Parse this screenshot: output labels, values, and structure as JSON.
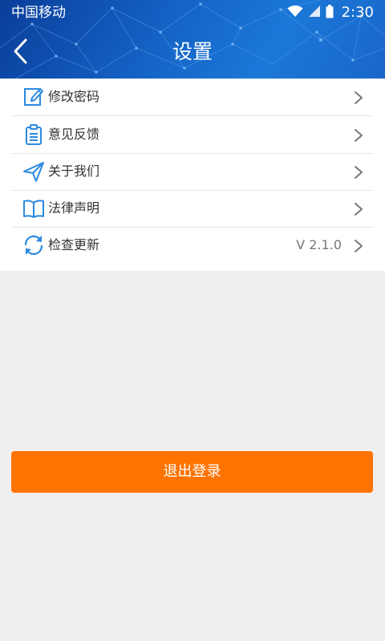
{
  "status_bar": {
    "carrier": "中国移动",
    "time": "2:30",
    "icons": [
      "wifi-icon",
      "signal-icon",
      "battery-icon"
    ]
  },
  "header": {
    "title": "设置",
    "back_icon": "chevron-left-icon"
  },
  "menu": {
    "items": [
      {
        "label": "修改密码",
        "icon": "edit-icon",
        "value": ""
      },
      {
        "label": "意见反馈",
        "icon": "clipboard-icon",
        "value": ""
      },
      {
        "label": "关于我们",
        "icon": "paper-plane-icon",
        "value": ""
      },
      {
        "label": "法律声明",
        "icon": "book-icon",
        "value": ""
      },
      {
        "label": "检查更新",
        "icon": "refresh-icon",
        "value": "V 2.1.0"
      }
    ]
  },
  "logout": {
    "label": "退出登录"
  },
  "colors": {
    "header_blue": "#1565c8",
    "accent_icon": "#2b8ae0",
    "logout_orange": "#ff7400",
    "background": "#efefef"
  }
}
